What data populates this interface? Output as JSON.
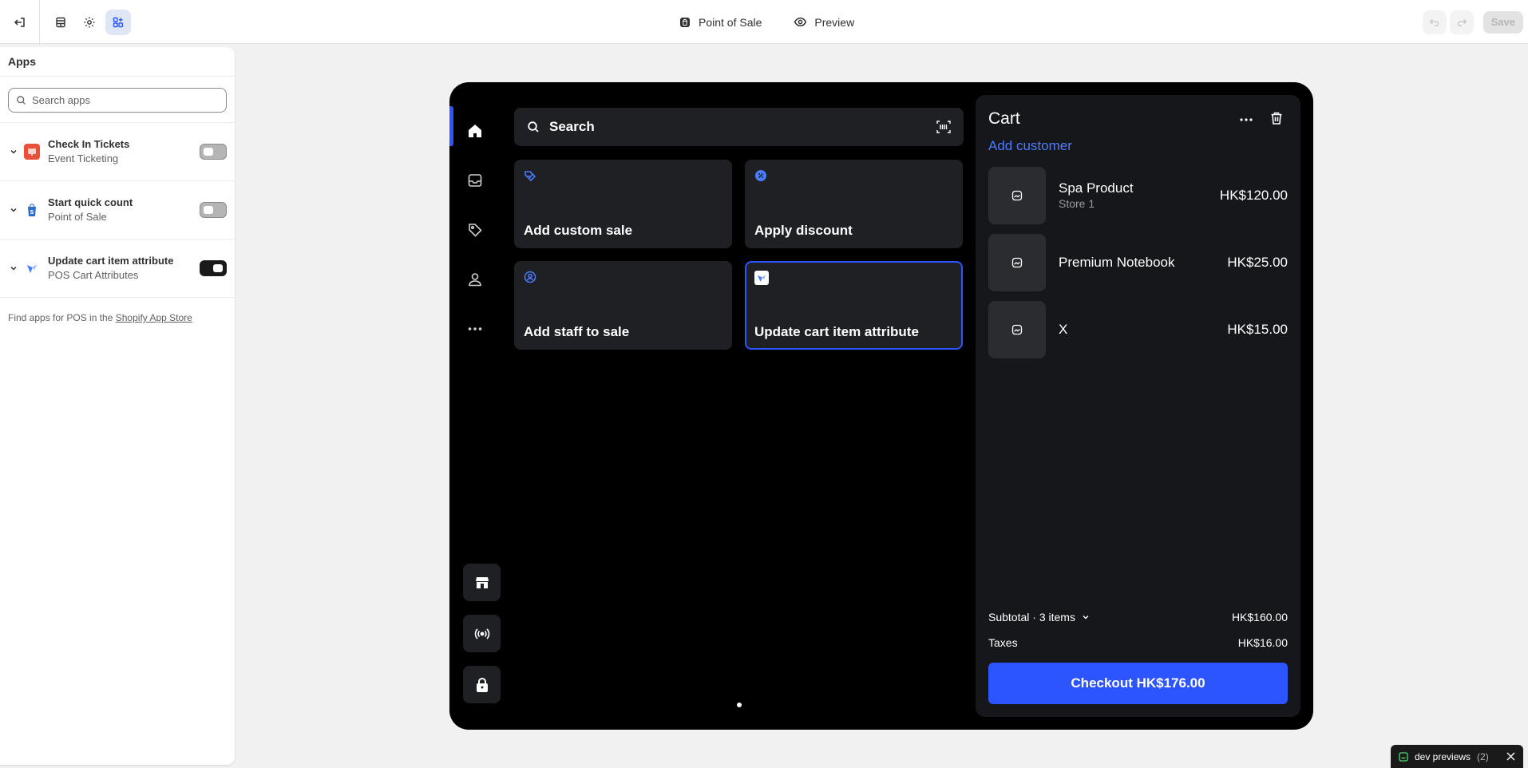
{
  "topbar": {
    "center_title": "Point of Sale",
    "preview_label": "Preview",
    "save_label": "Save"
  },
  "panel": {
    "title": "Apps",
    "search_placeholder": "Search apps",
    "apps": [
      {
        "name": "Check In Tickets",
        "sub": "Event Ticketing",
        "enabled": false
      },
      {
        "name": "Start quick count",
        "sub": "Point of Sale",
        "enabled": false
      },
      {
        "name": "Update cart item attribute",
        "sub": "POS Cart Attributes",
        "enabled": true
      }
    ],
    "find_prefix": "Find apps for POS in the",
    "find_link": "Shopify App Store"
  },
  "pos": {
    "search_label": "Search",
    "tiles": [
      {
        "label": "Add custom sale",
        "icon": "tag-check-icon"
      },
      {
        "label": "Apply discount",
        "icon": "discount-icon"
      },
      {
        "label": "Add staff to sale",
        "icon": "staff-icon"
      },
      {
        "label": "Update cart item attribute",
        "icon": "app-icon",
        "selected": true
      }
    ]
  },
  "cart": {
    "title": "Cart",
    "add_customer": "Add customer",
    "items": [
      {
        "name": "Spa Product",
        "sub": "Store 1",
        "price": "HK$120.00"
      },
      {
        "name": "Premium Notebook",
        "sub": "",
        "price": "HK$25.00"
      },
      {
        "name": "X",
        "sub": "",
        "price": "HK$15.00"
      }
    ],
    "subtotal_label": "Subtotal · 3 items",
    "subtotal_value": "HK$160.00",
    "taxes_label": "Taxes",
    "taxes_value": "HK$16.00",
    "checkout_label": "Checkout HK$176.00"
  },
  "dev": {
    "label": "dev previews",
    "count": "(2)"
  },
  "colors": {
    "accent": "#2c54ff",
    "link": "#4b7bff"
  }
}
